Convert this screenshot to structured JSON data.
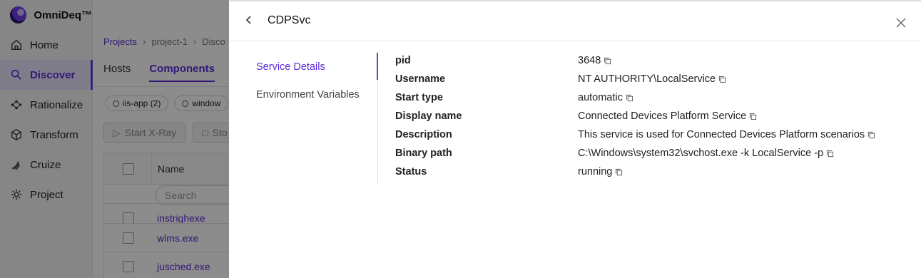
{
  "app": {
    "brand": "OmniDeq™",
    "nav": [
      {
        "label": "Home",
        "icon": "home-icon"
      },
      {
        "label": "Discover",
        "icon": "discover-icon",
        "active": true
      },
      {
        "label": "Rationalize",
        "icon": "rationalize-icon"
      },
      {
        "label": "Transform",
        "icon": "cube-icon"
      },
      {
        "label": "Cruize",
        "icon": "cruize-icon"
      },
      {
        "label": "Project",
        "icon": "gear-icon"
      }
    ],
    "breadcrumb": {
      "root": "Projects",
      "project": "project-1",
      "current": "Disco"
    },
    "tabs": [
      {
        "label": "Hosts"
      },
      {
        "label": "Components",
        "active": true
      }
    ],
    "chips": [
      "iis-app (2)",
      "window"
    ],
    "actions": {
      "start": "Start X-Ray",
      "stop": "Sto"
    },
    "table": {
      "name_header": "Name",
      "search_placeholder": "Search",
      "rows": [
        "instrighexe",
        "wlms.exe",
        "jusched.exe"
      ]
    },
    "accent": "#5b2bd9"
  },
  "drawer": {
    "title": "CDPSvc",
    "nav": [
      {
        "label": "Service Details",
        "active": true
      },
      {
        "label": "Environment Variables"
      }
    ],
    "details": [
      {
        "key": "pid",
        "value": "3648"
      },
      {
        "key": "Username",
        "value": "NT AUTHORITY\\LocalService"
      },
      {
        "key": "Start type",
        "value": "automatic"
      },
      {
        "key": "Display name",
        "value": "Connected Devices Platform Service"
      },
      {
        "key": "Description",
        "value": "This service is used for Connected Devices Platform scenarios"
      },
      {
        "key": "Binary path",
        "value": "C:\\Windows\\system32\\svchost.exe -k LocalService -p"
      },
      {
        "key": "Status",
        "value": "running"
      }
    ]
  }
}
